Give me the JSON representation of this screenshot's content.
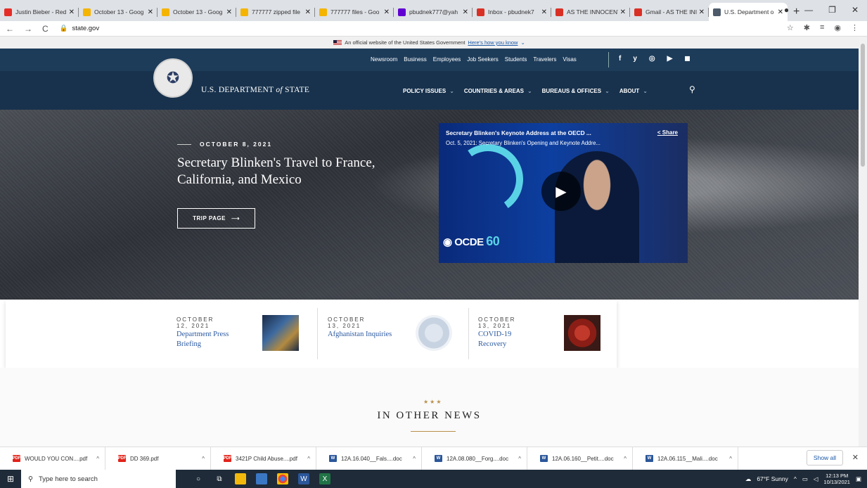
{
  "browser": {
    "tabs": [
      {
        "title": "Justin Bieber - Red",
        "color": "#e52d27",
        "icon": "youtube-icon"
      },
      {
        "title": "October 13 - Goog",
        "color": "#f4b400",
        "icon": "drive-icon"
      },
      {
        "title": "October 13 - Goog",
        "color": "#f4b400",
        "icon": "drive-icon"
      },
      {
        "title": "777777 zipped file",
        "color": "#f4b400",
        "icon": "drive-icon"
      },
      {
        "title": "777777 files - Goo",
        "color": "#f4b400",
        "icon": "drive-icon"
      },
      {
        "title": "pbudnek777@yah",
        "color": "#6001d2",
        "icon": "mail-icon"
      },
      {
        "title": "Inbox - pbudnek7",
        "color": "#d93025",
        "icon": "gmail-icon"
      },
      {
        "title": "AS THE INNOCENT",
        "color": "#d93025",
        "icon": "gmail-icon"
      },
      {
        "title": "Gmail - AS THE INI",
        "color": "#d93025",
        "icon": "gmail-icon"
      },
      {
        "title": "U.S. Department o",
        "color": "#4d5b6b",
        "icon": "state-seal-icon",
        "active": true
      }
    ],
    "new_tab": "+",
    "url": "state.gov"
  },
  "banner": {
    "text": "An official website of the United States Government",
    "link": "Here's how you know"
  },
  "top_links": [
    "Newsroom",
    "Business",
    "Employees",
    "Job Seekers",
    "Students",
    "Travelers",
    "Visas"
  ],
  "social": [
    "f",
    "y",
    "◎",
    "▶",
    "◼"
  ],
  "site": {
    "title_pre": "U.S. DEPARTMENT ",
    "title_of": "of",
    "title_post": " STATE"
  },
  "main_menu": [
    "POLICY ISSUES",
    "COUNTRIES & AREAS",
    "BUREAUS & OFFICES",
    "ABOUT"
  ],
  "hero": {
    "date": "OCTOBER 8, 2021",
    "title": "Secretary Blinken's Travel to France, California, and Mexico",
    "button": "TRIP PAGE"
  },
  "video": {
    "title": "Secretary Blinken's Keynote Address at the OECD ...",
    "subtitle": "Oct. 5, 2021: Secretary Blinken's Opening and Keynote Addre...",
    "share": "Share",
    "logo_text": "OCDE",
    "logo_num": "60"
  },
  "cards": [
    {
      "date": "OCTOBER 12, 2021",
      "title": "Department Press Briefing"
    },
    {
      "date": "OCTOBER 13, 2021",
      "title": "Afghanistan Inquiries"
    },
    {
      "date": "OCTOBER 13, 2021",
      "title": "COVID-19 Recovery"
    }
  ],
  "news": {
    "stars": "★★★",
    "heading": "IN OTHER NEWS"
  },
  "downloads": [
    {
      "name": "WOULD YOU CON....pdf",
      "type": "PDF",
      "color": "#e2231a"
    },
    {
      "name": "DD 369.pdf",
      "type": "PDF",
      "color": "#e2231a"
    },
    {
      "name": "3421P Child Abuse....pdf",
      "type": "PDF",
      "color": "#e2231a"
    },
    {
      "name": "12A.16.040__Fals....doc",
      "type": "W",
      "color": "#2b579a"
    },
    {
      "name": "12A.08.080__Forg....doc",
      "type": "W",
      "color": "#2b579a"
    },
    {
      "name": "12A.06.160__Petit....doc",
      "type": "W",
      "color": "#2b579a"
    },
    {
      "name": "12A.06.115__Mali....doc",
      "type": "W",
      "color": "#2b579a"
    }
  ],
  "show_all": "Show all",
  "taskbar": {
    "search_placeholder": "Type here to search",
    "weather": "67°F Sunny",
    "time": "12:13 PM",
    "date": "10/13/2021"
  }
}
